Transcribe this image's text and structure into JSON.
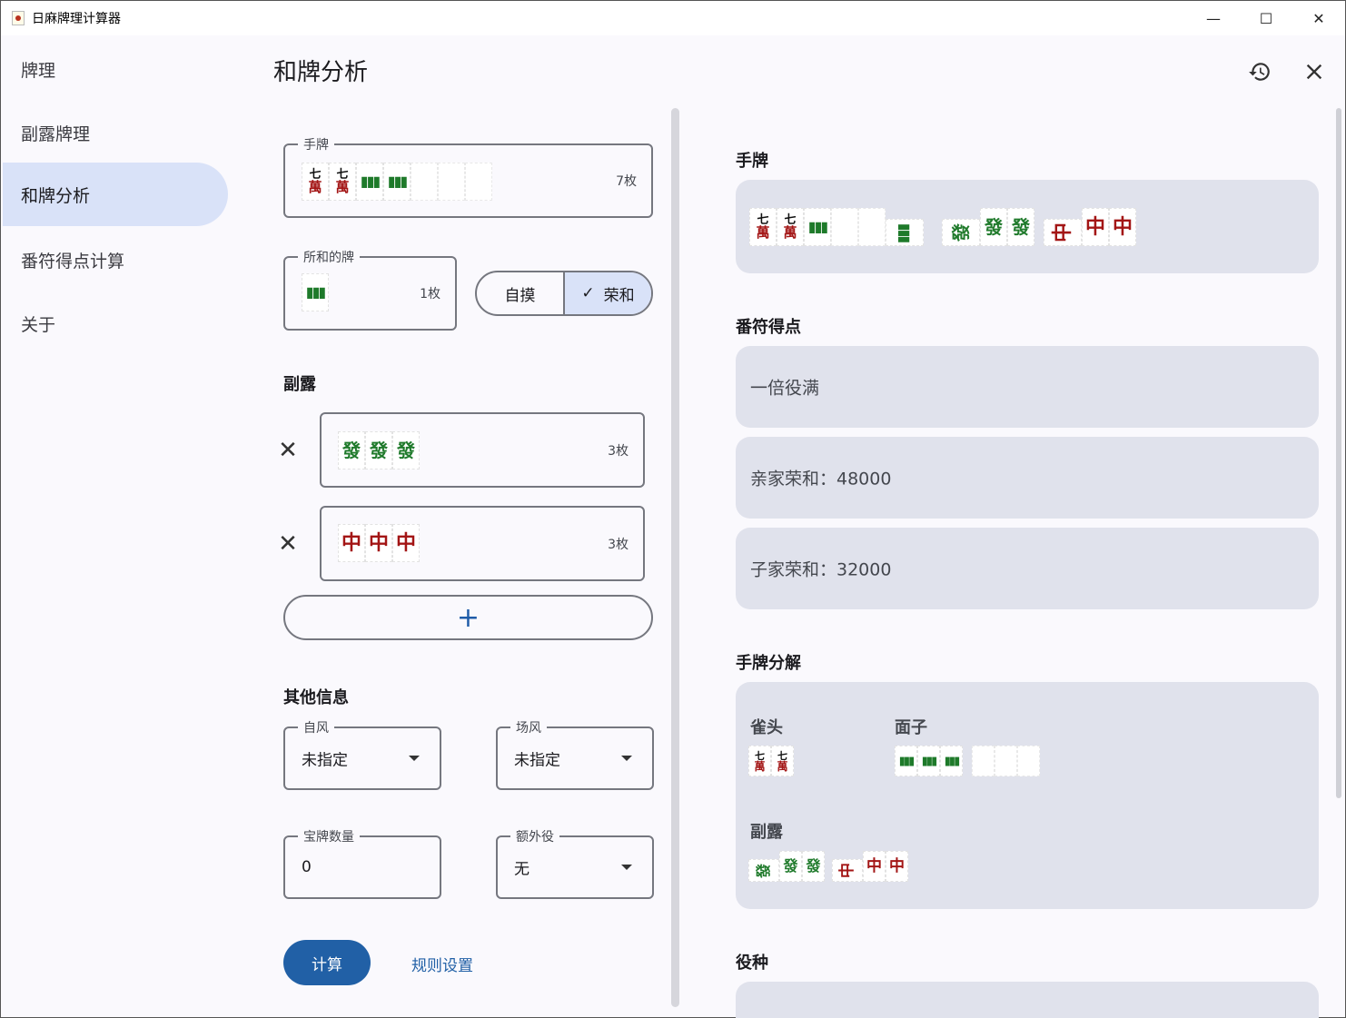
{
  "window": {
    "title": "日麻牌理计算器",
    "controls": {
      "minimize": "—",
      "maximize": "☐",
      "close": "✕"
    }
  },
  "sidebar": {
    "items": [
      {
        "label": "牌理"
      },
      {
        "label": "副露牌理"
      },
      {
        "label": "和牌分析"
      },
      {
        "label": "番符得点计算"
      },
      {
        "label": "关于"
      }
    ],
    "active": "和牌分析"
  },
  "header": {
    "title": "和牌分析",
    "history_icon": "history-icon",
    "close_icon": "close-icon"
  },
  "form": {
    "hand": {
      "label": "手牌",
      "count": "7枚"
    },
    "winning_tile": {
      "label": "所和的牌",
      "count": "1枚"
    },
    "win_type": {
      "tsumo": "自摸",
      "ron": "荣和",
      "selected": "荣和",
      "check": "✓"
    },
    "calls": {
      "heading": "副露",
      "items": [
        {
          "count": "3枚",
          "remove": "✕"
        },
        {
          "count": "3枚",
          "remove": "✕"
        }
      ],
      "add": "+"
    },
    "other": {
      "heading": "其他信息",
      "seat_wind": {
        "label": "自风",
        "value": "未指定"
      },
      "round_wind": {
        "label": "场风",
        "value": "未指定"
      },
      "dora": {
        "label": "宝牌数量",
        "value": "0"
      },
      "extra_yaku": {
        "label": "额外役",
        "value": "无"
      }
    },
    "calculate": "计算",
    "rules": "规则设置"
  },
  "tiles": {
    "man7": {
      "num": "七",
      "kanji": "萬"
    },
    "hatsu": "發",
    "chun": "中"
  },
  "result": {
    "hand_heading": "手牌",
    "score_heading": "番符得点",
    "yakuman": "一倍役满",
    "dealer_ron": "亲家荣和：48000",
    "nondealer_ron": "子家荣和：32000",
    "decomp_heading": "手牌分解",
    "pair_label": "雀头",
    "meld_label": "面子",
    "calls_label": "副露",
    "yaku_heading": "役种"
  },
  "colors": {
    "accent": "#2160a6",
    "selected_bg": "#d9e2f8",
    "card_bg": "#e0e2ec",
    "man_red": "#a31515",
    "sou_green": "#1e7a2a"
  }
}
